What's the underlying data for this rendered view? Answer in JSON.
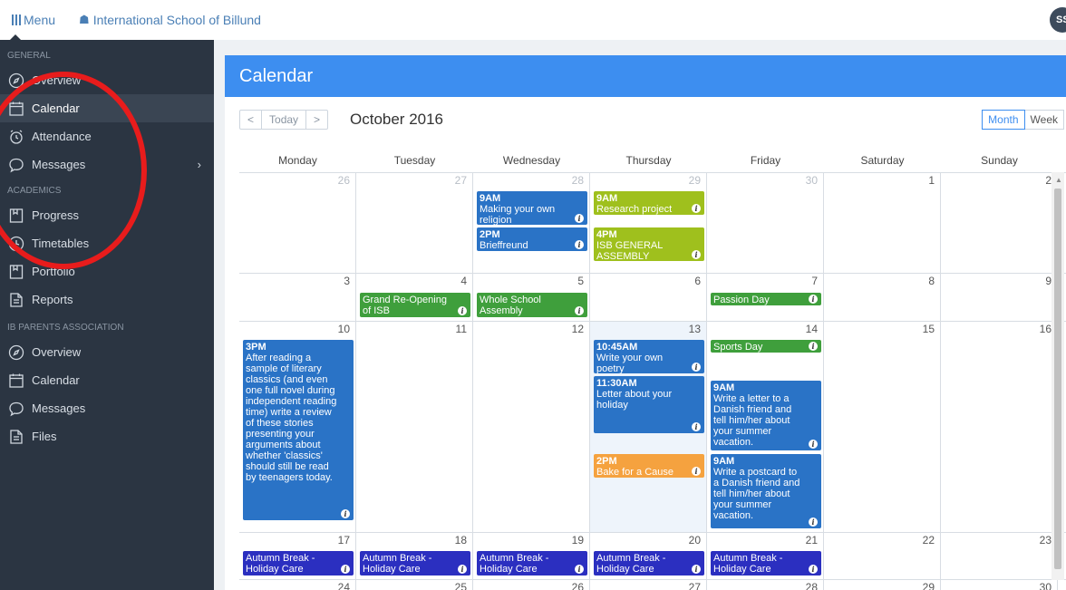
{
  "topbar": {
    "menu_label": "Menu",
    "school_name": "International School of Billund",
    "avatar_initials": "SS"
  },
  "sidebar": {
    "general_title": "GENERAL",
    "general_items": [
      {
        "label": "Overview",
        "icon": "compass-icon"
      },
      {
        "label": "Calendar",
        "icon": "calendar-icon",
        "active": true
      },
      {
        "label": "Attendance",
        "icon": "alarm-clock-icon"
      },
      {
        "label": "Messages",
        "icon": "chat-icon",
        "has_submenu": true
      }
    ],
    "academics_title": "ACADEMICS",
    "academics_items": [
      {
        "label": "Progress",
        "icon": "book-icon"
      },
      {
        "label": "Timetables",
        "icon": "clock-icon"
      },
      {
        "label": "Portfolio",
        "icon": "book-icon"
      },
      {
        "label": "Reports",
        "icon": "document-icon"
      }
    ],
    "parents_title": "IB PARENTS ASSOCIATION",
    "parents_items": [
      {
        "label": "Overview",
        "icon": "compass-icon"
      },
      {
        "label": "Calendar",
        "icon": "calendar-icon"
      },
      {
        "label": "Messages",
        "icon": "chat-icon"
      },
      {
        "label": "Files",
        "icon": "document-icon"
      }
    ]
  },
  "calendar": {
    "title": "Calendar",
    "today_label": "Today",
    "prev_label": "<",
    "next_label": ">",
    "month_title": "October 2016",
    "views": [
      "Month",
      "Week"
    ],
    "active_view": "Month",
    "weekdays": [
      "Monday",
      "Tuesday",
      "Wednesday",
      "Thursday",
      "Friday",
      "Saturday",
      "Sunday"
    ],
    "weeks": [
      {
        "days": [
          {
            "num": "26",
            "other": true,
            "events": []
          },
          {
            "num": "27",
            "other": true,
            "events": []
          },
          {
            "num": "28",
            "other": true,
            "events": [
              {
                "time": "9AM",
                "title": "Making your own religion",
                "color": "#2a73c6"
              },
              {
                "time": "2PM",
                "title": "Brieffreund",
                "color": "#2a73c6"
              }
            ]
          },
          {
            "num": "29",
            "other": true,
            "events": [
              {
                "time": "9AM",
                "title": "Research project",
                "color": "#9fc01d"
              },
              {
                "time": "4PM",
                "title": "ISB GENERAL ASSEMBLY",
                "color": "#9fc01d"
              }
            ]
          },
          {
            "num": "30",
            "other": true,
            "events": []
          },
          {
            "num": "1",
            "events": []
          },
          {
            "num": "2",
            "events": []
          }
        ]
      },
      {
        "days": [
          {
            "num": "3",
            "events": []
          },
          {
            "num": "4",
            "events": [
              {
                "title": "Grand Re-Opening of ISB",
                "color": "#3f9f3c"
              }
            ]
          },
          {
            "num": "5",
            "events": [
              {
                "title": "Whole School Assembly",
                "color": "#3f9f3c"
              }
            ]
          },
          {
            "num": "6",
            "events": []
          },
          {
            "num": "7",
            "events": [
              {
                "title": "Passion Day",
                "color": "#3f9f3c"
              }
            ]
          },
          {
            "num": "8",
            "events": []
          },
          {
            "num": "9",
            "events": []
          }
        ]
      },
      {
        "days": [
          {
            "num": "10",
            "events": [
              {
                "time": "3PM",
                "title": "After reading a sample of literary classics (and even one full novel during independent reading time) write a review of these stories presenting your arguments about whether 'classics' should still be read by teenagers today.",
                "color": "#2a73c6"
              }
            ]
          },
          {
            "num": "11",
            "events": []
          },
          {
            "num": "12",
            "events": []
          },
          {
            "num": "13",
            "today": true,
            "events": [
              {
                "time": "10:45AM",
                "title": "Write your own poetry",
                "color": "#2a73c6"
              },
              {
                "time": "11:30AM",
                "title": "Letter about your holiday",
                "color": "#2a73c6"
              },
              {
                "time": "2PM",
                "title": "Bake for a Cause",
                "color": "#f5a23f"
              }
            ]
          },
          {
            "num": "14",
            "events": [
              {
                "title": "Sports Day",
                "color": "#3f9f3c"
              },
              {
                "time": "9AM",
                "title": "Write a letter to a Danish friend and tell him/her about your summer vacation.",
                "color": "#2a73c6"
              },
              {
                "time": "9AM",
                "title": "Write a postcard to a Danish friend and tell him/her about your summer vacation.",
                "color": "#2a73c6"
              }
            ]
          },
          {
            "num": "15",
            "events": []
          },
          {
            "num": "16",
            "events": []
          }
        ]
      },
      {
        "days": [
          {
            "num": "17",
            "events": [
              {
                "title": "Autumn Break - Holiday Care",
                "color": "#2b2fc0"
              }
            ]
          },
          {
            "num": "18",
            "events": [
              {
                "title": "Autumn Break - Holiday Care",
                "color": "#2b2fc0"
              }
            ]
          },
          {
            "num": "19",
            "events": [
              {
                "title": "Autumn Break - Holiday Care",
                "color": "#2b2fc0"
              }
            ]
          },
          {
            "num": "20",
            "events": [
              {
                "title": "Autumn Break - Holiday Care",
                "color": "#2b2fc0"
              }
            ]
          },
          {
            "num": "21",
            "events": [
              {
                "title": "Autumn Break - Holiday Care",
                "color": "#2b2fc0"
              }
            ]
          },
          {
            "num": "22",
            "events": []
          },
          {
            "num": "23",
            "events": []
          }
        ]
      },
      {
        "days": [
          {
            "num": "24",
            "events": []
          },
          {
            "num": "25",
            "events": []
          },
          {
            "num": "26",
            "events": []
          },
          {
            "num": "27",
            "events": []
          },
          {
            "num": "28",
            "events": []
          },
          {
            "num": "29",
            "events": []
          },
          {
            "num": "30",
            "events": []
          }
        ]
      }
    ]
  },
  "annotation": {
    "shape": "red-ellipse",
    "color": "#e81c1c"
  }
}
